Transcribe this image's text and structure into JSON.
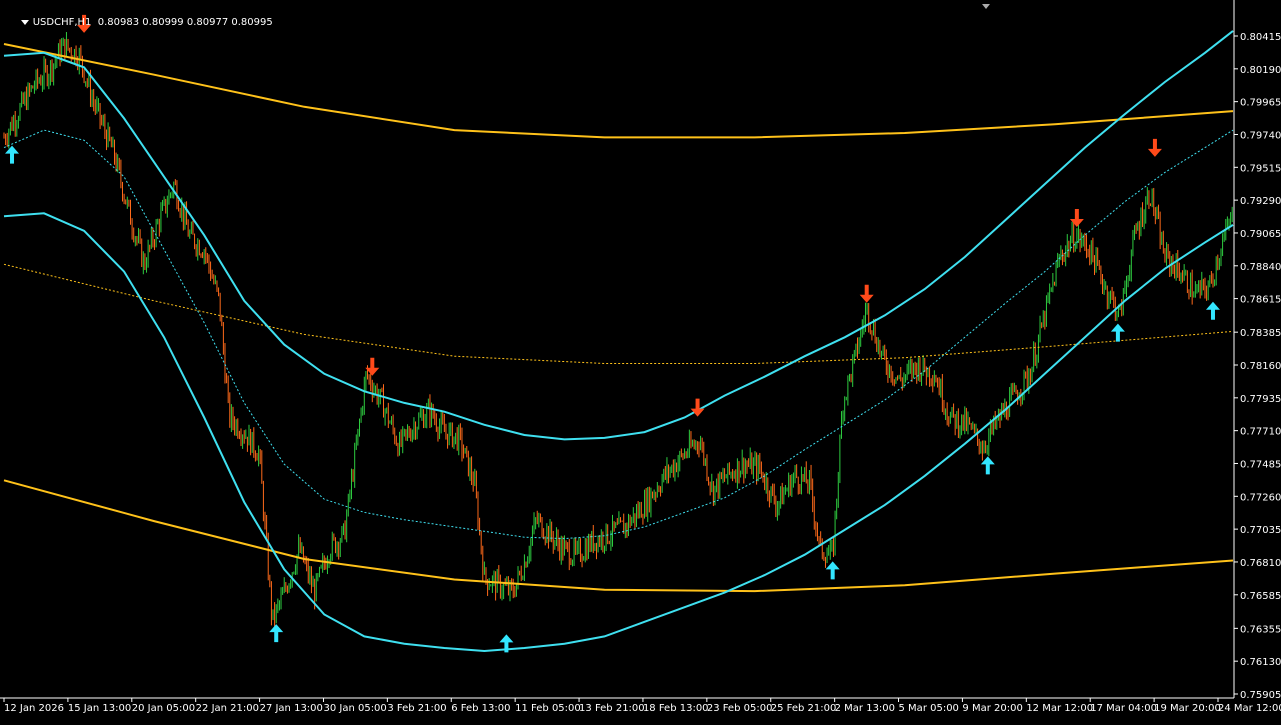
{
  "header": {
    "symbol": "USDCHF,H1",
    "quote": "0.80983 0.80999 0.80977 0.80995"
  },
  "colors": {
    "background": "#000000",
    "bull": "#2ecc40",
    "bear": "#ff6a1a",
    "cyan": "#3fe0f0",
    "gold": "#ffc21a",
    "down_arrow": "#ff4a1a",
    "up_arrow": "#33e6ff",
    "axis": "#ffffff"
  },
  "chart_data": {
    "type": "line",
    "title": "",
    "y_tick_labels": [
      "0.80415",
      "0.80190",
      "0.79965",
      "0.79740",
      "0.79515",
      "0.79290",
      "0.79065",
      "0.78840",
      "0.78615",
      "0.78385",
      "0.78160",
      "0.77935",
      "0.77710",
      "0.77485",
      "0.77260",
      "0.77035",
      "0.76810",
      "0.76585",
      "0.76355",
      "0.76130",
      "0.75905"
    ],
    "ylim": [
      0.75905,
      0.80415
    ],
    "x_tick_labels": [
      "12 Jan 2026",
      "15 Jan 13:00",
      "20 Jan 05:00",
      "22 Jan 21:00",
      "27 Jan 13:00",
      "30 Jan 05:00",
      "3 Feb 21:00",
      "6 Feb 13:00",
      "11 Feb 05:00",
      "13 Feb 21:00",
      "18 Feb 13:00",
      "23 Feb 05:00",
      "25 Feb 21:00",
      "2 Mar 13:00",
      "5 Mar 05:00",
      "9 Mar 20:00",
      "12 Mar 12:00",
      "17 Mar 04:00",
      "19 Mar 20:00",
      "24 Mar 12:00"
    ],
    "x_index_range": [
      0,
      1000
    ],
    "price_path": [
      {
        "t": 0,
        "p": 0.7972
      },
      {
        "t": 15,
        "p": 0.799
      },
      {
        "t": 30,
        "p": 0.8008
      },
      {
        "t": 45,
        "p": 0.8018
      },
      {
        "t": 60,
        "p": 0.8035
      },
      {
        "t": 75,
        "p": 0.8028
      },
      {
        "t": 90,
        "p": 0.7995
      },
      {
        "t": 110,
        "p": 0.796
      },
      {
        "t": 125,
        "p": 0.792
      },
      {
        "t": 140,
        "p": 0.7885
      },
      {
        "t": 155,
        "p": 0.7915
      },
      {
        "t": 170,
        "p": 0.794
      },
      {
        "t": 185,
        "p": 0.7905
      },
      {
        "t": 200,
        "p": 0.7895
      },
      {
        "t": 215,
        "p": 0.786
      },
      {
        "t": 225,
        "p": 0.778
      },
      {
        "t": 240,
        "p": 0.777
      },
      {
        "t": 255,
        "p": 0.7755
      },
      {
        "t": 268,
        "p": 0.764
      },
      {
        "t": 280,
        "p": 0.766
      },
      {
        "t": 295,
        "p": 0.769
      },
      {
        "t": 310,
        "p": 0.766
      },
      {
        "t": 325,
        "p": 0.769
      },
      {
        "t": 340,
        "p": 0.77
      },
      {
        "t": 352,
        "p": 0.776
      },
      {
        "t": 362,
        "p": 0.781
      },
      {
        "t": 378,
        "p": 0.779
      },
      {
        "t": 395,
        "p": 0.776
      },
      {
        "t": 410,
        "p": 0.7775
      },
      {
        "t": 425,
        "p": 0.7785
      },
      {
        "t": 440,
        "p": 0.777
      },
      {
        "t": 455,
        "p": 0.7765
      },
      {
        "t": 470,
        "p": 0.7735
      },
      {
        "t": 480,
        "p": 0.767
      },
      {
        "t": 495,
        "p": 0.7665
      },
      {
        "t": 508,
        "p": 0.766
      },
      {
        "t": 520,
        "p": 0.768
      },
      {
        "t": 532,
        "p": 0.771
      },
      {
        "t": 545,
        "p": 0.77
      },
      {
        "t": 558,
        "p": 0.769
      },
      {
        "t": 572,
        "p": 0.7685
      },
      {
        "t": 588,
        "p": 0.7695
      },
      {
        "t": 605,
        "p": 0.77
      },
      {
        "t": 620,
        "p": 0.7705
      },
      {
        "t": 640,
        "p": 0.772
      },
      {
        "t": 660,
        "p": 0.774
      },
      {
        "t": 680,
        "p": 0.7755
      },
      {
        "t": 695,
        "p": 0.7765
      },
      {
        "t": 708,
        "p": 0.773
      },
      {
        "t": 722,
        "p": 0.774
      },
      {
        "t": 738,
        "p": 0.7748
      },
      {
        "t": 755,
        "p": 0.7745
      },
      {
        "t": 772,
        "p": 0.772
      },
      {
        "t": 790,
        "p": 0.774
      },
      {
        "t": 805,
        "p": 0.7735
      },
      {
        "t": 815,
        "p": 0.769
      },
      {
        "t": 828,
        "p": 0.7685
      },
      {
        "t": 838,
        "p": 0.779
      },
      {
        "t": 850,
        "p": 0.782
      },
      {
        "t": 862,
        "p": 0.7855
      },
      {
        "t": 878,
        "p": 0.782
      },
      {
        "t": 895,
        "p": 0.7805
      },
      {
        "t": 912,
        "p": 0.7815
      },
      {
        "t": 930,
        "p": 0.781
      },
      {
        "t": 945,
        "p": 0.778
      },
      {
        "t": 962,
        "p": 0.7775
      },
      {
        "t": 978,
        "p": 0.776
      },
      {
        "t": 995,
        "p": 0.778
      },
      {
        "t": 1010,
        "p": 0.7795
      },
      {
        "t": 1025,
        "p": 0.781
      },
      {
        "t": 1040,
        "p": 0.785
      },
      {
        "t": 1055,
        "p": 0.789
      },
      {
        "t": 1070,
        "p": 0.7905
      },
      {
        "t": 1085,
        "p": 0.7895
      },
      {
        "t": 1100,
        "p": 0.787
      },
      {
        "t": 1115,
        "p": 0.785
      },
      {
        "t": 1130,
        "p": 0.7905
      },
      {
        "t": 1145,
        "p": 0.7935
      },
      {
        "t": 1160,
        "p": 0.789
      },
      {
        "t": 1175,
        "p": 0.788
      },
      {
        "t": 1190,
        "p": 0.7865
      },
      {
        "t": 1205,
        "p": 0.787
      },
      {
        "t": 1215,
        "p": 0.7895
      },
      {
        "t": 1228,
        "p": 0.792
      }
    ],
    "series": [
      {
        "color": "#ffc21a",
        "style": "solid",
        "points": [
          [
            0,
            0.8036
          ],
          [
            150,
            0.8015
          ],
          [
            300,
            0.7993
          ],
          [
            450,
            0.7977
          ],
          [
            600,
            0.7972
          ],
          [
            750,
            0.7972
          ],
          [
            900,
            0.7975
          ],
          [
            1050,
            0.7981
          ],
          [
            1228,
            0.799
          ]
        ]
      },
      {
        "color": "#ffc21a",
        "style": "dotted",
        "points": [
          [
            0,
            0.7885
          ],
          [
            150,
            0.786
          ],
          [
            300,
            0.7837
          ],
          [
            450,
            0.7822
          ],
          [
            600,
            0.7817
          ],
          [
            750,
            0.7817
          ],
          [
            900,
            0.7821
          ],
          [
            1050,
            0.7829
          ],
          [
            1228,
            0.7839
          ]
        ]
      },
      {
        "color": "#ffc21a",
        "style": "solid",
        "points": [
          [
            0,
            0.7737
          ],
          [
            150,
            0.7709
          ],
          [
            300,
            0.7683
          ],
          [
            450,
            0.7669
          ],
          [
            600,
            0.7662
          ],
          [
            750,
            0.7661
          ],
          [
            900,
            0.7665
          ],
          [
            1050,
            0.7673
          ],
          [
            1228,
            0.7682
          ]
        ]
      },
      {
        "color": "#3fe0f0",
        "style": "solid",
        "points": [
          [
            0,
            0.8028
          ],
          [
            40,
            0.803
          ],
          [
            80,
            0.802
          ],
          [
            120,
            0.7985
          ],
          [
            160,
            0.7945
          ],
          [
            200,
            0.7905
          ],
          [
            240,
            0.786
          ],
          [
            280,
            0.783
          ],
          [
            320,
            0.781
          ],
          [
            360,
            0.7798
          ],
          [
            400,
            0.779
          ],
          [
            440,
            0.7784
          ],
          [
            480,
            0.7775
          ],
          [
            520,
            0.7768
          ],
          [
            560,
            0.7765
          ],
          [
            600,
            0.7766
          ],
          [
            640,
            0.777
          ],
          [
            680,
            0.778
          ],
          [
            720,
            0.7795
          ],
          [
            760,
            0.7808
          ],
          [
            800,
            0.7822
          ],
          [
            840,
            0.7835
          ],
          [
            880,
            0.785
          ],
          [
            920,
            0.7868
          ],
          [
            960,
            0.789
          ],
          [
            1000,
            0.7915
          ],
          [
            1040,
            0.794
          ],
          [
            1080,
            0.7965
          ],
          [
            1120,
            0.7988
          ],
          [
            1160,
            0.801
          ],
          [
            1200,
            0.803
          ],
          [
            1228,
            0.8045
          ]
        ]
      },
      {
        "color": "#3fe0f0",
        "style": "dotted",
        "points": [
          [
            0,
            0.7965
          ],
          [
            40,
            0.7977
          ],
          [
            80,
            0.797
          ],
          [
            120,
            0.7945
          ],
          [
            160,
            0.7895
          ],
          [
            200,
            0.7845
          ],
          [
            240,
            0.779
          ],
          [
            280,
            0.7748
          ],
          [
            320,
            0.7724
          ],
          [
            360,
            0.7715
          ],
          [
            400,
            0.771
          ],
          [
            440,
            0.7706
          ],
          [
            480,
            0.7702
          ],
          [
            520,
            0.7698
          ],
          [
            560,
            0.7697
          ],
          [
            600,
            0.7699
          ],
          [
            640,
            0.7705
          ],
          [
            680,
            0.7715
          ],
          [
            720,
            0.7725
          ],
          [
            760,
            0.774
          ],
          [
            800,
            0.7758
          ],
          [
            840,
            0.7775
          ],
          [
            880,
            0.7792
          ],
          [
            920,
            0.7812
          ],
          [
            960,
            0.7835
          ],
          [
            1000,
            0.7858
          ],
          [
            1040,
            0.788
          ],
          [
            1080,
            0.7905
          ],
          [
            1120,
            0.7928
          ],
          [
            1160,
            0.7948
          ],
          [
            1200,
            0.7965
          ],
          [
            1228,
            0.7977
          ]
        ]
      },
      {
        "color": "#3fe0f0",
        "style": "solid",
        "points": [
          [
            0,
            0.7918
          ],
          [
            40,
            0.792
          ],
          [
            80,
            0.7908
          ],
          [
            120,
            0.788
          ],
          [
            160,
            0.7835
          ],
          [
            200,
            0.778
          ],
          [
            240,
            0.7722
          ],
          [
            280,
            0.7676
          ],
          [
            320,
            0.7645
          ],
          [
            360,
            0.763
          ],
          [
            400,
            0.7625
          ],
          [
            440,
            0.7622
          ],
          [
            480,
            0.762
          ],
          [
            520,
            0.7622
          ],
          [
            560,
            0.7625
          ],
          [
            600,
            0.763
          ],
          [
            640,
            0.764
          ],
          [
            680,
            0.765
          ],
          [
            720,
            0.766
          ],
          [
            760,
            0.7672
          ],
          [
            800,
            0.7686
          ],
          [
            840,
            0.7703
          ],
          [
            880,
            0.772
          ],
          [
            920,
            0.774
          ],
          [
            960,
            0.7762
          ],
          [
            1000,
            0.7785
          ],
          [
            1040,
            0.781
          ],
          [
            1080,
            0.7835
          ],
          [
            1120,
            0.786
          ],
          [
            1160,
            0.7882
          ],
          [
            1200,
            0.79
          ],
          [
            1228,
            0.7912
          ]
        ]
      }
    ],
    "signals": [
      {
        "type": "sell",
        "t": 80,
        "p": 0.8045
      },
      {
        "type": "buy",
        "t": 8,
        "p": 0.7965
      },
      {
        "type": "buy",
        "t": 272,
        "p": 0.7637
      },
      {
        "type": "sell",
        "t": 368,
        "p": 0.781
      },
      {
        "type": "buy",
        "t": 502,
        "p": 0.763
      },
      {
        "type": "sell",
        "t": 693,
        "p": 0.7782
      },
      {
        "type": "buy",
        "t": 828,
        "p": 0.768
      },
      {
        "type": "sell",
        "t": 862,
        "p": 0.786
      },
      {
        "type": "buy",
        "t": 983,
        "p": 0.7752
      },
      {
        "type": "sell",
        "t": 1072,
        "p": 0.7912
      },
      {
        "type": "buy",
        "t": 1113,
        "p": 0.7843
      },
      {
        "type": "sell",
        "t": 1150,
        "p": 0.796
      },
      {
        "type": "buy",
        "t": 1208,
        "p": 0.7858
      }
    ]
  }
}
